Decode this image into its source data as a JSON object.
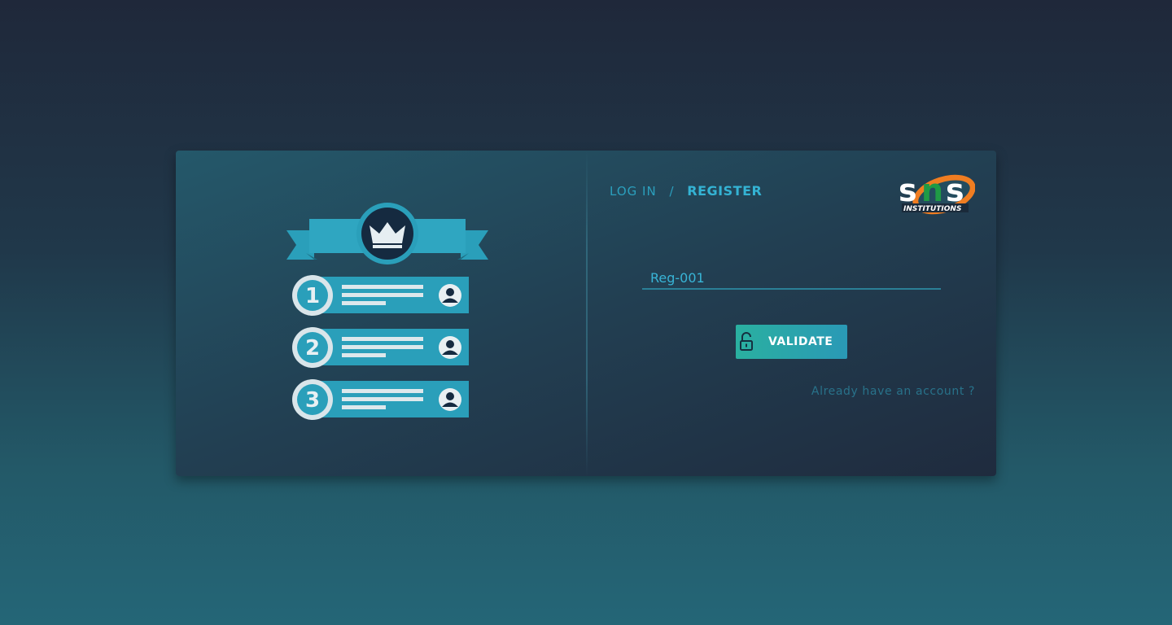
{
  "auth_tabs": {
    "login_label": "LOG IN",
    "separator": "/",
    "register_label": "REGISTER"
  },
  "logo": {
    "wordmark": "sns",
    "subtitle": "INSTITUTIONS"
  },
  "form": {
    "register_number_value": "Reg-001"
  },
  "buttons": {
    "validate_label": "VALIDATE"
  },
  "links": {
    "already_have_account": "Already have an account ?"
  },
  "illustration": {
    "ranks": [
      "1",
      "2",
      "3"
    ],
    "icons": [
      "crown-icon",
      "user-avatar-icon",
      "lock-icon"
    ]
  },
  "colors": {
    "accent": "#2a9fba",
    "button_start": "#2ab0a0",
    "button_end": "#2a99b6",
    "logo_orange": "#f07d21",
    "logo_green": "#1f9a45"
  }
}
